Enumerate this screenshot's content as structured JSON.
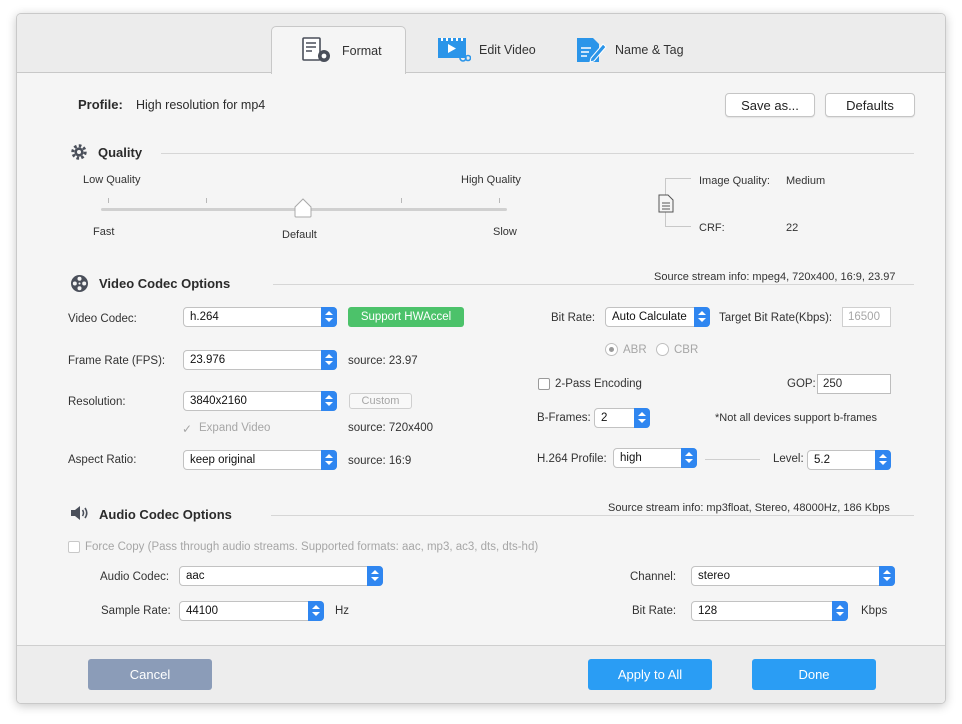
{
  "tabs": [
    {
      "label": "Format",
      "icon": "format-settings-icon",
      "active": true
    },
    {
      "label": "Edit Video",
      "icon": "edit-video-icon",
      "active": false
    },
    {
      "label": "Name & Tag",
      "icon": "name-tag-icon",
      "active": false
    }
  ],
  "profile": {
    "label": "Profile:",
    "value": "High resolution for mp4",
    "save_as": "Save as...",
    "defaults": "Defaults"
  },
  "quality": {
    "title": "Quality",
    "low_label": "Low Quality",
    "high_label": "High Quality",
    "fast_label": "Fast",
    "default_label": "Default",
    "slow_label": "Slow",
    "slider_value": "Default",
    "image_quality_label": "Image Quality:",
    "image_quality_value": "Medium",
    "crf_label": "CRF:",
    "crf_value": "22"
  },
  "video": {
    "title": "Video Codec Options",
    "source_info": "Source stream info: mpeg4, 720x400, 16:9, 23.97",
    "codec_label": "Video Codec:",
    "codec_value": "h.264",
    "hwaccel_label": "Support HWAccel",
    "framerate_label": "Frame Rate (FPS):",
    "framerate_value": "23.976",
    "framerate_source": "source: 23.97",
    "resolution_label": "Resolution:",
    "resolution_value": "3840x2160",
    "custom_label": "Custom",
    "expand_label": "Expand Video",
    "resolution_source": "source: 720x400",
    "aspect_label": "Aspect Ratio:",
    "aspect_value": "keep original",
    "aspect_source": "source: 16:9",
    "bitrate_label": "Bit Rate:",
    "bitrate_value": "Auto Calculate",
    "target_label": "Target Bit Rate(Kbps):",
    "target_value": "16500",
    "abr_label": "ABR",
    "cbr_label": "CBR",
    "twopass_label": "2-Pass Encoding",
    "gop_label": "GOP:",
    "gop_value": "250",
    "bframes_label": "B-Frames:",
    "bframes_value": "2",
    "bframes_note": "*Not all devices support b-frames",
    "profile_label": "H.264 Profile:",
    "profile_value": "high",
    "level_label": "Level:",
    "level_value": "5.2"
  },
  "audio": {
    "title": "Audio Codec Options",
    "source_info": "Source stream info: mp3float, Stereo, 48000Hz, 186 Kbps",
    "forcecopy_label": "Force Copy (Pass through audio streams. Supported formats: aac, mp3, ac3, dts, dts-hd)",
    "codec_label": "Audio Codec:",
    "codec_value": "aac",
    "channel_label": "Channel:",
    "channel_value": "stereo",
    "samplerate_label": "Sample Rate:",
    "samplerate_value": "44100",
    "samplerate_unit": "Hz",
    "bitrate_label": "Bit Rate:",
    "bitrate_value": "128",
    "bitrate_unit": "Kbps"
  },
  "footer": {
    "cancel": "Cancel",
    "apply_all": "Apply to All",
    "done": "Done"
  },
  "colors": {
    "accent": "#2a9df4",
    "hwaccel": "#4cc26a",
    "cancel": "#8b9cb8"
  }
}
